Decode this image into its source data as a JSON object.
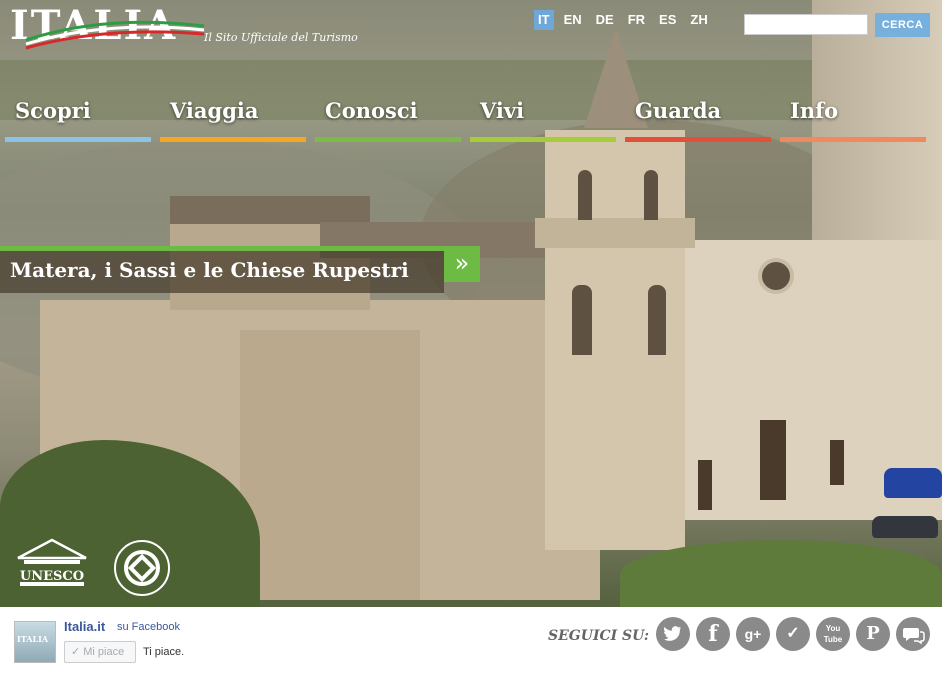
{
  "header": {
    "logo_text": "ITALIA",
    "tagline": "Il Sito Ufficiale del Turismo",
    "languages": [
      {
        "code": "IT",
        "active": true
      },
      {
        "code": "EN",
        "active": false
      },
      {
        "code": "DE",
        "active": false
      },
      {
        "code": "FR",
        "active": false
      },
      {
        "code": "ES",
        "active": false
      },
      {
        "code": "ZH",
        "active": false
      }
    ],
    "search": {
      "placeholder": "",
      "button_label": "CERCA"
    }
  },
  "nav": {
    "items": [
      {
        "label": "Scopri",
        "color": "#8ec3e8"
      },
      {
        "label": "Viaggia",
        "color": "#f5a623"
      },
      {
        "label": "Conosci",
        "color": "#7dba4a"
      },
      {
        "label": "Vivi",
        "color": "#a6cc3a"
      },
      {
        "label": "Guarda",
        "color": "#e2503a"
      },
      {
        "label": "Info",
        "color": "#f08a5d"
      }
    ]
  },
  "feature": {
    "title": "Matera, i Sassi e le Chiese Rupestri",
    "arrow_icon": "»",
    "accent_color": "#6dba45"
  },
  "badges": {
    "unesco_text": "UNESCO"
  },
  "footer": {
    "facebook": {
      "page_name": "Italia.it",
      "suffix": "su Facebook",
      "like_button": "✓ Mi piace",
      "like_text": "Ti piace."
    },
    "follow_label": "SEGUICI SU:",
    "social": [
      {
        "icon": "twitter-icon",
        "glyph": "t"
      },
      {
        "icon": "facebook-icon",
        "glyph": "f"
      },
      {
        "icon": "google-plus-icon",
        "glyph": "g+"
      },
      {
        "icon": "foursquare-icon",
        "glyph": "✓"
      },
      {
        "icon": "youtube-icon",
        "glyph": "You Tube"
      },
      {
        "icon": "pinterest-icon",
        "glyph": "P"
      },
      {
        "icon": "chat-icon",
        "glyph": "💬"
      }
    ]
  }
}
